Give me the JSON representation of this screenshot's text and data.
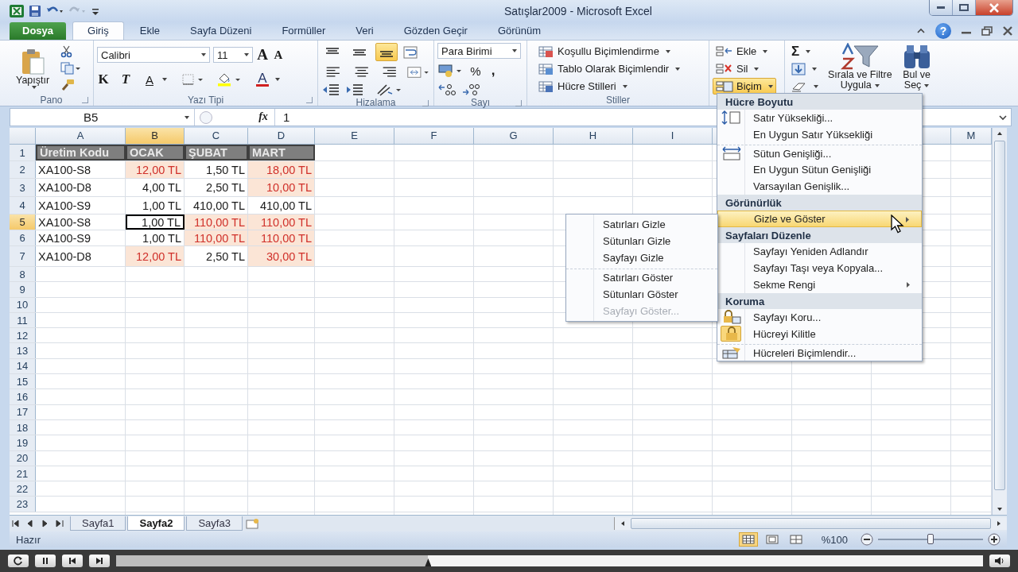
{
  "window": {
    "title": "Satışlar2009  -  Microsoft Excel"
  },
  "tabs": [
    {
      "label": "Dosya",
      "kind": "file",
      "selected": false
    },
    {
      "label": "Giriş",
      "kind": "tab",
      "selected": true
    },
    {
      "label": "Ekle",
      "kind": "tab",
      "selected": false
    },
    {
      "label": "Sayfa Düzeni",
      "kind": "tab",
      "selected": false
    },
    {
      "label": "Formüller",
      "kind": "tab",
      "selected": false
    },
    {
      "label": "Veri",
      "kind": "tab",
      "selected": false
    },
    {
      "label": "Gözden Geçir",
      "kind": "tab",
      "selected": false
    },
    {
      "label": "Görünüm",
      "kind": "tab",
      "selected": false
    }
  ],
  "help": "?",
  "ribbon": {
    "clipboard": {
      "label": "Pano",
      "paste": "Yapıştır"
    },
    "font": {
      "label": "Yazı Tipi",
      "name": "Calibri",
      "size": "11",
      "grow_key": "A",
      "shrink_key": "A",
      "bold_key": "K",
      "italic_key": "T",
      "underline_key": "A",
      "font_color_key": "A"
    },
    "alignment": {
      "label": "Hizalama",
      "vertical": [
        {
          "selected": false
        },
        {
          "selected": false
        },
        {
          "selected": true
        }
      ]
    },
    "number": {
      "label": "Sayı",
      "format": "Para Birimi",
      "percent": "%",
      "comma": ","
    },
    "styles": {
      "label": "Stiller",
      "items": [
        "Koşullu Biçimlendirme",
        "Tablo Olarak Biçimlendir",
        "Hücre Stilleri"
      ]
    },
    "cells": {
      "items": [
        {
          "label": "Ekle",
          "selected": false
        },
        {
          "label": "Sil",
          "selected": false
        },
        {
          "label": "Biçim",
          "selected": true
        }
      ]
    },
    "editing": {
      "sum": "Σ",
      "sort_lines": [
        "Sırala ve Filtre",
        "Uygula"
      ],
      "find_lines": [
        "Bul ve",
        "Seç"
      ]
    }
  },
  "formula_bar": {
    "name_box": "B5",
    "fx": "fx",
    "value": "1"
  },
  "columns": [
    {
      "label": "A",
      "selected": false
    },
    {
      "label": "B",
      "selected": true
    },
    {
      "label": "C",
      "selected": false
    },
    {
      "label": "D",
      "selected": false
    },
    {
      "label": "E",
      "selected": false
    },
    {
      "label": "F",
      "selected": false
    },
    {
      "label": "G",
      "selected": false
    },
    {
      "label": "H",
      "selected": false
    },
    {
      "label": "I",
      "selected": false
    },
    {
      "label": "M",
      "selected": false
    }
  ],
  "rows": [
    {
      "number": "1",
      "selected": false,
      "cells": [
        {
          "text": "Üretim Kodu",
          "kind": "heading",
          "highlight": false,
          "active": false
        },
        {
          "text": "OCAK",
          "kind": "heading",
          "highlight": false,
          "active": false
        },
        {
          "text": "ŞUBAT",
          "kind": "heading",
          "highlight": false,
          "active": false
        },
        {
          "text": "MART",
          "kind": "heading",
          "highlight": false,
          "active": false
        }
      ]
    },
    {
      "number": "2",
      "selected": false,
      "cells": [
        {
          "text": "XA100-S8",
          "kind": "label",
          "highlight": false,
          "active": false
        },
        {
          "text": "12,00 TL",
          "kind": "amount",
          "highlight": true,
          "active": false
        },
        {
          "text": "1,50 TL",
          "kind": "amount",
          "highlight": false,
          "active": false
        },
        {
          "text": "18,00 TL",
          "kind": "amount",
          "highlight": true,
          "active": false
        }
      ]
    },
    {
      "number": "3",
      "selected": false,
      "cells": [
        {
          "text": "XA100-D8",
          "kind": "label",
          "highlight": false,
          "active": false
        },
        {
          "text": "4,00 TL",
          "kind": "amount",
          "highlight": false,
          "active": false
        },
        {
          "text": "2,50 TL",
          "kind": "amount",
          "highlight": false,
          "active": false
        },
        {
          "text": "10,00 TL",
          "kind": "amount",
          "highlight": true,
          "active": false
        }
      ]
    },
    {
      "number": "4",
      "selected": false,
      "cells": [
        {
          "text": "XA100-S9",
          "kind": "label",
          "highlight": false,
          "active": false
        },
        {
          "text": "1,00 TL",
          "kind": "amount",
          "highlight": false,
          "active": false
        },
        {
          "text": "410,00 TL",
          "kind": "amount",
          "highlight": false,
          "active": false
        },
        {
          "text": "410,00 TL",
          "kind": "amount",
          "highlight": false,
          "active": false
        }
      ]
    },
    {
      "number": "5",
      "selected": true,
      "cells": [
        {
          "text": "XA100-S8",
          "kind": "label",
          "highlight": false,
          "active": false
        },
        {
          "text": "1,00 TL",
          "kind": "amount",
          "highlight": false,
          "active": true
        },
        {
          "text": "110,00 TL",
          "kind": "amount",
          "highlight": true,
          "active": false
        },
        {
          "text": "110,00 TL",
          "kind": "amount",
          "highlight": true,
          "active": false
        }
      ]
    },
    {
      "number": "6",
      "selected": false,
      "cells": [
        {
          "text": "XA100-S9",
          "kind": "label",
          "highlight": false,
          "active": false
        },
        {
          "text": "1,00 TL",
          "kind": "amount",
          "highlight": false,
          "active": false
        },
        {
          "text": "110,00 TL",
          "kind": "amount",
          "highlight": true,
          "active": false
        },
        {
          "text": "110,00 TL",
          "kind": "amount",
          "highlight": true,
          "active": false
        }
      ]
    },
    {
      "number": "7",
      "selected": false,
      "cells": [
        {
          "text": "XA100-D8",
          "kind": "label",
          "highlight": false,
          "active": false
        },
        {
          "text": "12,00 TL",
          "kind": "amount",
          "highlight": true,
          "active": false
        },
        {
          "text": "2,50 TL",
          "kind": "amount",
          "highlight": false,
          "active": false
        },
        {
          "text": "30,00 TL",
          "kind": "amount",
          "highlight": true,
          "active": false
        }
      ]
    },
    {
      "number": "8",
      "selected": false
    },
    {
      "number": "9",
      "selected": false
    },
    {
      "number": "10",
      "selected": false
    },
    {
      "number": "11",
      "selected": false
    },
    {
      "number": "12",
      "selected": false
    },
    {
      "number": "13",
      "selected": false
    },
    {
      "number": "14",
      "selected": false
    },
    {
      "number": "15",
      "selected": false
    },
    {
      "number": "16",
      "selected": false
    },
    {
      "number": "17",
      "selected": false
    },
    {
      "number": "18",
      "selected": false
    },
    {
      "number": "19",
      "selected": false
    },
    {
      "number": "20",
      "selected": false
    },
    {
      "number": "21",
      "selected": false
    },
    {
      "number": "22",
      "selected": false
    },
    {
      "number": "23",
      "selected": false
    }
  ],
  "sheet_tabs": [
    {
      "label": "Sayfa1",
      "selected": false
    },
    {
      "label": "Sayfa2",
      "selected": true
    },
    {
      "label": "Sayfa3",
      "selected": false
    }
  ],
  "status_bar": {
    "text": "Hazır",
    "views": [
      {
        "selected": true
      },
      {
        "selected": false
      },
      {
        "selected": false
      }
    ],
    "zoom": "%100",
    "zoom_slider": {
      "level": 0.5
    }
  },
  "format_menu": [
    {
      "kind": "header",
      "label": "Hücre Boyutu"
    },
    {
      "kind": "rows",
      "label": "Satır Yüksekliği...",
      "selected": false,
      "submenu": false,
      "checked": false,
      "divider_above": false
    },
    {
      "kind": "item",
      "label": "En Uygun Satır Yüksekliği",
      "selected": false,
      "submenu": false,
      "checked": false,
      "divider_above": false
    },
    {
      "kind": "cols",
      "label": "Sütun Genişliği...",
      "selected": false,
      "submenu": false,
      "checked": false,
      "divider_above": true
    },
    {
      "kind": "item",
      "label": "En Uygun Sütun Genişliği",
      "selected": false,
      "submenu": false,
      "checked": false,
      "divider_above": false
    },
    {
      "kind": "item",
      "label": "Varsayılan Genişlik...",
      "selected": false,
      "submenu": false,
      "checked": false,
      "divider_above": false
    },
    {
      "kind": "header",
      "label": "Görünürlük"
    },
    {
      "kind": "item",
      "label": "Gizle ve Göster",
      "selected": true,
      "submenu": true,
      "checked": false,
      "divider_above": false
    },
    {
      "kind": "header",
      "label": "Sayfaları Düzenle"
    },
    {
      "kind": "item",
      "label": "Sayfayı Yeniden Adlandır",
      "selected": false,
      "submenu": false,
      "checked": false,
      "divider_above": false
    },
    {
      "kind": "item",
      "label": "Sayfayı Taşı veya Kopyala...",
      "selected": false,
      "submenu": false,
      "checked": false,
      "divider_above": false
    },
    {
      "kind": "item",
      "label": "Sekme Rengi",
      "selected": false,
      "submenu": true,
      "checked": false,
      "divider_above": false
    },
    {
      "kind": "header",
      "label": "Koruma"
    },
    {
      "kind": "protect",
      "label": "Sayfayı Koru...",
      "selected": false,
      "submenu": false,
      "checked": false,
      "divider_above": false
    },
    {
      "kind": "lock",
      "label": "Hücreyi Kilitle",
      "selected": false,
      "submenu": false,
      "checked": true,
      "divider_above": false
    },
    {
      "kind": "format",
      "label": "Hücreleri Biçimlendir...",
      "selected": false,
      "submenu": false,
      "checked": false,
      "divider_above": true
    }
  ],
  "hide_submenu": [
    {
      "label": "Satırları Gizle",
      "disabled": false,
      "divider_above": false
    },
    {
      "label": "Sütunları Gizle",
      "disabled": false,
      "divider_above": false
    },
    {
      "label": "Sayfayı Gizle",
      "disabled": false,
      "divider_above": false
    },
    {
      "label": "Satırları Göster",
      "disabled": false,
      "divider_above": true
    },
    {
      "label": "Sütunları Göster",
      "disabled": false,
      "divider_above": false
    },
    {
      "label": "Sayfayı Göster...",
      "disabled": true,
      "divider_above": false
    }
  ],
  "player": {
    "level": 0.36
  }
}
